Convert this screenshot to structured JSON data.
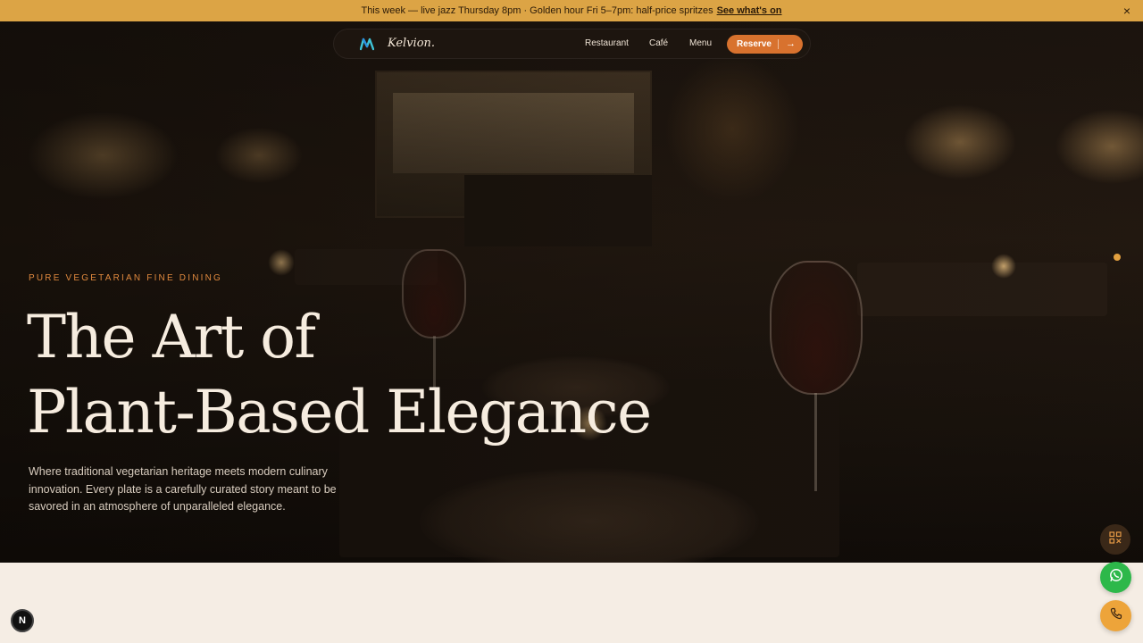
{
  "announcement": {
    "text": "This week — live jazz Thursday 8pm · Golden hour Fri 5–7pm: half-price spritzes",
    "link": "See what's on",
    "close": "×"
  },
  "nav": {
    "brand": "Kelvion.",
    "links": [
      "Restaurant",
      "Café",
      "Menu"
    ],
    "reserve": "Reserve",
    "reserve_arrow": "→"
  },
  "hero": {
    "eyebrow": "PURE VEGETARIAN FINE DINING",
    "headline_line1": "The Art of",
    "headline_line2": "Plant-Based Elegance",
    "lede": "Where traditional vegetarian heritage meets modern culinary innovation. Every plate is a carefully curated story meant to be savored in an atmosphere of unparalleled elegance."
  },
  "floating": {
    "qr_icon": "qr-code-icon",
    "whatsapp_icon": "whatsapp-icon",
    "phone_icon": "phone-icon",
    "dev_badge": "N"
  },
  "colors": {
    "accent": "#d8722e",
    "announce_bg": "#dca445",
    "cream": "#f5ede4",
    "whatsapp": "#2db84a",
    "phone": "#eda43a"
  }
}
